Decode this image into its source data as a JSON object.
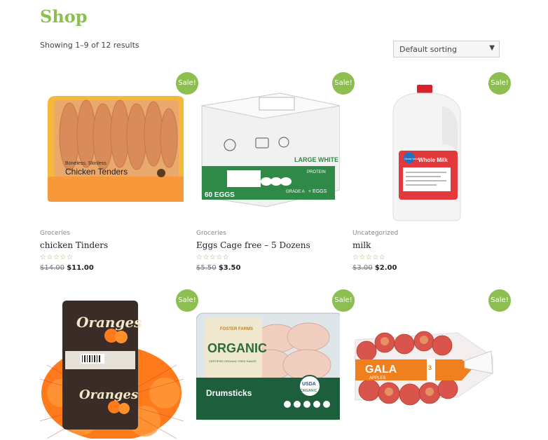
{
  "page": {
    "title": "Shop",
    "result_count": "Showing 1–9 of 12 results"
  },
  "sorting": {
    "selected": "Default sorting",
    "arrow": "▼"
  },
  "sale_badge": "Sale!",
  "stars": "☆☆☆☆☆",
  "products": [
    {
      "category": "Groceries",
      "name": "chicken Tinders",
      "old_price": "$14.00",
      "price": "$11.00",
      "icon": "chicken-tenders-tray"
    },
    {
      "category": "Groceries",
      "name": "Eggs Cage free – 5 Dozens",
      "old_price": "$5.50",
      "price": "$3.50",
      "icon": "egg-box"
    },
    {
      "category": "Uncategorized",
      "name": "milk",
      "old_price": "$3.00",
      "price": "$2.00",
      "icon": "milk-gallon"
    },
    {
      "category": "",
      "name": "",
      "old_price": "",
      "price": "",
      "icon": "oranges-bag"
    },
    {
      "category": "",
      "name": "",
      "old_price": "",
      "price": "",
      "icon": "chicken-drumsticks-tray"
    },
    {
      "category": "",
      "name": "",
      "old_price": "",
      "price": "",
      "icon": "gala-apples-bag"
    }
  ],
  "product_image_text": {
    "chicken_label": "Chicken Tenders",
    "chicken_small": "Boneless, Skinless",
    "eggs_large": "LARGE WHITE",
    "eggs_count": "60 EGGS",
    "eggs_grade": "GRADE A",
    "eggs_plus": "+ EGGS",
    "eggs_protein": "PROTEIN",
    "milk_brand": "Great Value",
    "milk_label": "Whole Milk",
    "oranges_label": "Oranges",
    "drumsticks_brand": "FOSTER FARMS",
    "drumsticks_organic": "ORGANIC",
    "drumsticks_certified": "CERTIFIED ORGANIC FREE RANGE",
    "drumsticks_label": "Drumsticks",
    "usda": "USDA",
    "usda_organic": "ORGANIC",
    "gala_label": "GALA",
    "gala_sub": "APPLES",
    "gala_count": "3"
  }
}
